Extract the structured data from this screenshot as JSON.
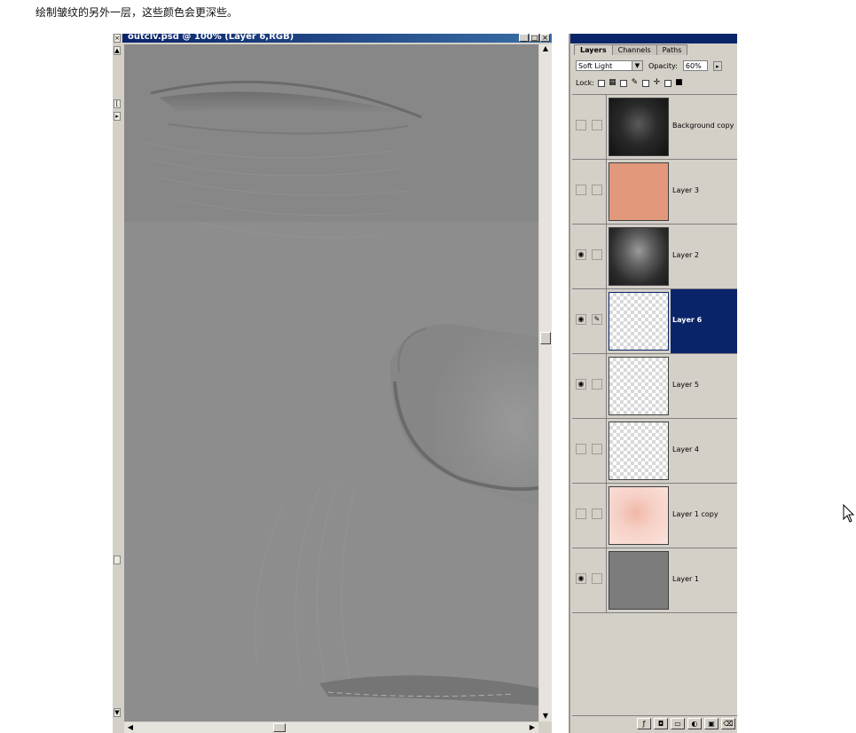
{
  "caption": "绘制皱纹的另外一层，这些颜色会更深些。",
  "document": {
    "title": "outclv.psd @ 100% (Layer 6,RGB)",
    "window_buttons": [
      "_",
      "□",
      "×"
    ]
  },
  "palette": {
    "tabs": [
      "Layers",
      "Channels",
      "Paths"
    ],
    "active_tab": "Layers",
    "blend_mode": "Soft Light",
    "opacity_label": "Opacity:",
    "opacity_value": "60%",
    "lock_label": "Lock:",
    "layers": [
      {
        "name": "Background copy",
        "visible": false,
        "thumb": "dark-face"
      },
      {
        "name": "Layer 3",
        "visible": false,
        "thumb": "orange"
      },
      {
        "name": "Layer 2",
        "visible": true,
        "thumb": "face"
      },
      {
        "name": "Layer 6",
        "visible": true,
        "thumb": "transparent",
        "selected": true
      },
      {
        "name": "Layer 5",
        "visible": true,
        "thumb": "transparent"
      },
      {
        "name": "Layer 4",
        "visible": false,
        "thumb": "transparent"
      },
      {
        "name": "Layer 1 copy",
        "visible": false,
        "thumb": "pink-face"
      },
      {
        "name": "Layer 1",
        "visible": true,
        "thumb": "gray"
      }
    ],
    "colors": {
      "orange": "#e2987a",
      "gray": "#7c7c7c",
      "pink": "#f6d0c6",
      "selected": "#0a246a"
    }
  },
  "icons": {
    "eye": "eye-icon",
    "brush": "brush-icon",
    "cursor": "mouse-cursor-icon"
  }
}
